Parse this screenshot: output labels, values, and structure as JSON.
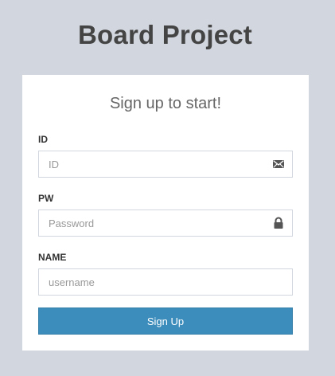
{
  "app": {
    "title": "Board Project"
  },
  "form": {
    "heading": "Sign up to start!",
    "fields": {
      "id": {
        "label": "ID",
        "placeholder": "ID",
        "value": "",
        "icon": "envelope-icon"
      },
      "pw": {
        "label": "PW",
        "placeholder": "Password",
        "value": "",
        "icon": "lock-icon"
      },
      "name": {
        "label": "NAME",
        "placeholder": "username",
        "value": ""
      }
    },
    "submit_label": "Sign Up"
  },
  "colors": {
    "page_background": "#d2d6de",
    "card_background": "#ffffff",
    "button_primary": "#3c8dbc",
    "title_text": "#444444"
  }
}
